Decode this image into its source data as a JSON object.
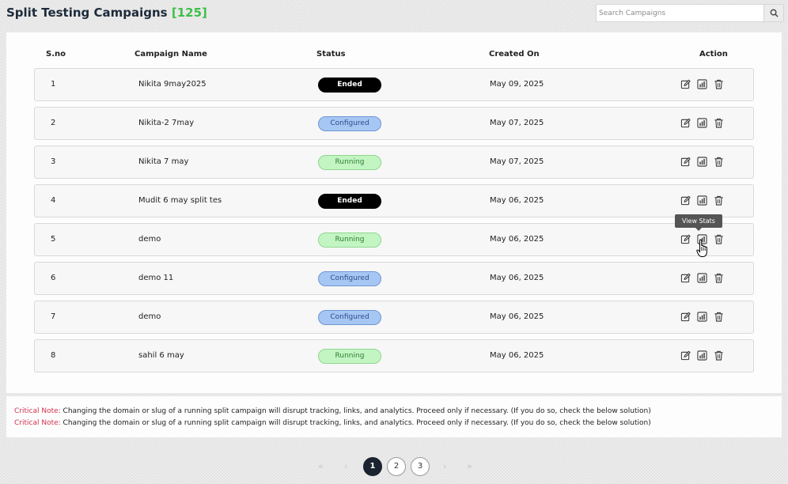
{
  "header": {
    "title": "Split Testing Campaigns",
    "count": "[125]",
    "search": {
      "placeholder": "Search Campaigns"
    }
  },
  "table": {
    "columns": [
      "S.no",
      "Campaign Name",
      "Status",
      "Created On",
      "Action"
    ],
    "rows": [
      {
        "sno": "1",
        "name": "Nikita 9may2025",
        "status": "Ended",
        "status_type": "ended",
        "created": "May 09, 2025"
      },
      {
        "sno": "2",
        "name": "Nikita-2 7may",
        "status": "Configured",
        "status_type": "configured",
        "created": "May 07, 2025"
      },
      {
        "sno": "3",
        "name": "Nikita 7 may",
        "status": "Running",
        "status_type": "running",
        "created": "May 07, 2025"
      },
      {
        "sno": "4",
        "name": "Mudit 6 may split tes",
        "status": "Ended",
        "status_type": "ended",
        "created": "May 06, 2025"
      },
      {
        "sno": "5",
        "name": "demo",
        "status": "Running",
        "status_type": "running",
        "created": "May 06, 2025"
      },
      {
        "sno": "6",
        "name": "demo 11",
        "status": "Configured",
        "status_type": "configured",
        "created": "May 06, 2025"
      },
      {
        "sno": "7",
        "name": "demo",
        "status": "Configured",
        "status_type": "configured",
        "created": "May 06, 2025"
      },
      {
        "sno": "8",
        "name": "sahil 6 may",
        "status": "Running",
        "status_type": "running",
        "created": "May 06, 2025"
      }
    ],
    "action_icons": [
      "edit-icon",
      "view-stats-icon",
      "delete-icon"
    ],
    "tooltip": "View Stats"
  },
  "notes": [
    {
      "label": "Critical Note:",
      "text": " Changing the domain or slug of a running split campaign will disrupt tracking, links, and analytics. Proceed only if necessary. (If you do so, check the below solution)"
    },
    {
      "label": "Critical Note:",
      "text": " Changing the domain or slug of a running split campaign will disrupt tracking, links, and analytics. Proceed only if necessary. (If you do so, check the below solution)"
    }
  ],
  "pagination": {
    "first": "«",
    "prev": "‹",
    "next": "›",
    "last": "»",
    "pages": [
      "1",
      "2",
      "3"
    ],
    "current": "1"
  },
  "colors": {
    "title_count": "#3fbf4a",
    "note_label": "#d0314c",
    "ended_bg": "#000000",
    "configured_bg": "#a6c6f4",
    "running_bg": "#c3f5c3",
    "active_page": "#1b2330"
  }
}
